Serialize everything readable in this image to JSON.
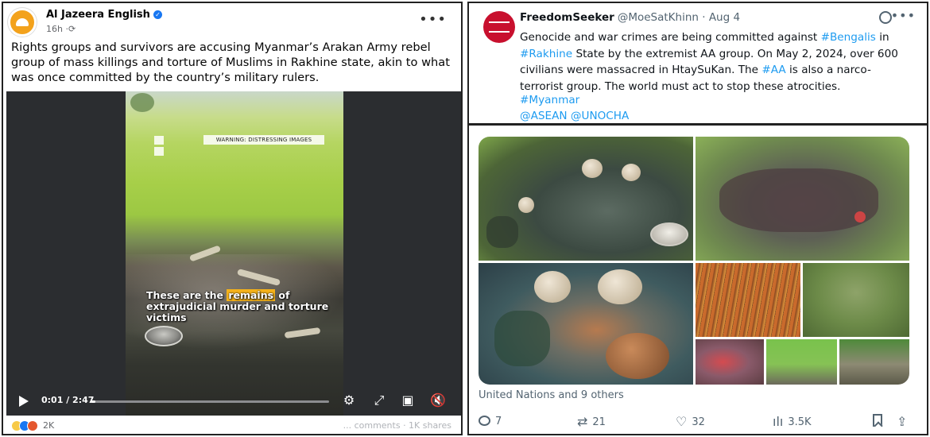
{
  "facebook_post": {
    "page_name": "Al Jazeera English",
    "time": "16h",
    "caption": "Rights groups and survivors are accusing Myanmar’s Arakan Army rebel group of mass killings and torture of Muslims in Rakhine state, akin to what was once committed by the country’s military rulers.",
    "video": {
      "warning": "WARNING: DISTRESSING IMAGES",
      "subtitle_before": "These are the",
      "subtitle_highlight": "remains",
      "subtitle_after": "of extrajudicial murder and torture victims",
      "time_display": "0:01 / 2:47",
      "progress": 0.006
    },
    "reactions_count": "2K",
    "stats": "... comments · 1K shares",
    "icons": [
      "verified-icon",
      "globe-icon",
      "more-icon",
      "play-icon",
      "settings-icon",
      "expand-icon",
      "pip-icon",
      "mute-icon"
    ]
  },
  "tweet": {
    "display_name": "FreedomSeeker",
    "handle": "@MoeSatKhinn",
    "date": "· Aug 4",
    "text_parts": {
      "p1": "Genocide and war crimes are being committed against ",
      "tag_bengalis": "#Bengalis",
      "p2": " in ",
      "tag_rakhine": "#Rakhine",
      "p3": " State by the extremist AA group. On May 2, 2024, over 600 civilians were massacred in HtaySuKan. The ",
      "tag_aa": "#AA",
      "p4": " is also a narco-terrorist group. The world must act to stop these atrocities."
    },
    "tag_myanmar": "#Myanmar",
    "mentions": "@ASEAN @UNOCHA",
    "tagged_people": "United Nations and 9 others",
    "actions": {
      "replies": "7",
      "reposts": "21",
      "likes": "32",
      "views": "3.5K"
    },
    "accent_color": "#1d9bf0"
  }
}
